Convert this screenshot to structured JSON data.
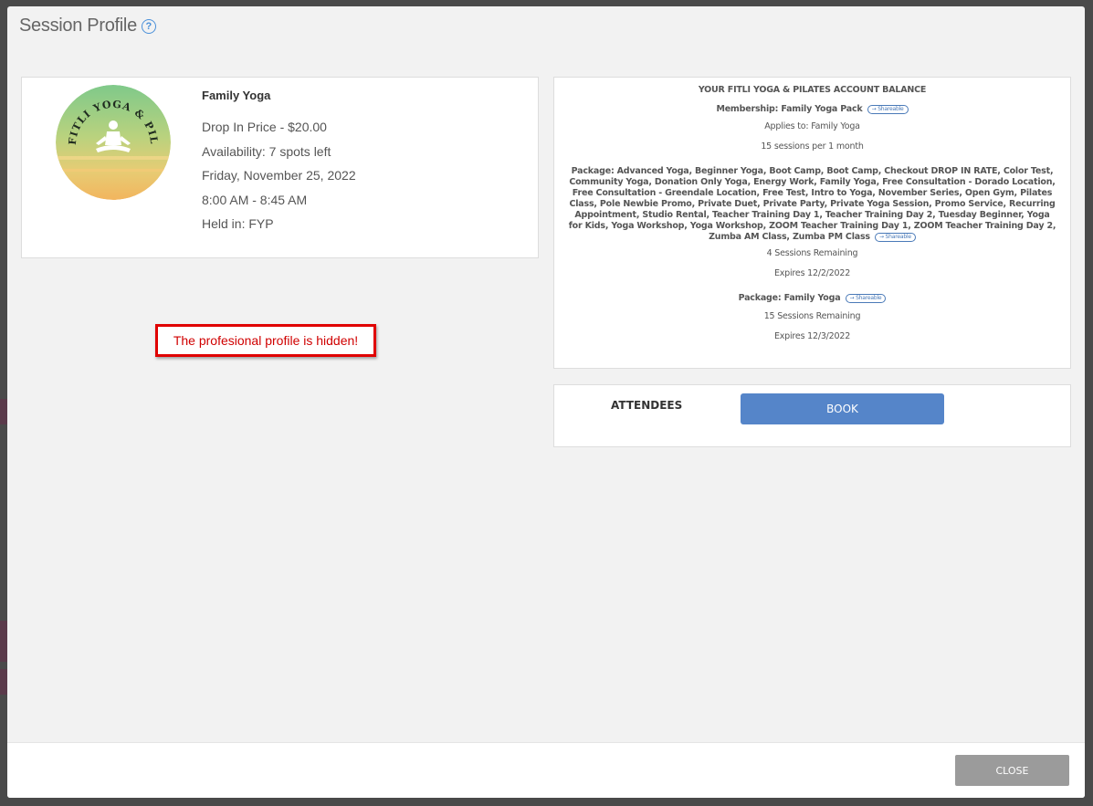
{
  "modal": {
    "title": "Session Profile",
    "help_icon": "?"
  },
  "session": {
    "logo_text": "FITLI YOGA & PILATES",
    "name": "Family Yoga",
    "price": "Drop In Price - $20.00",
    "availability": "Availability: 7 spots left",
    "date": "Friday, November 25, 2022",
    "time": "8:00 AM - 8:45 AM",
    "location": "Held in: FYP"
  },
  "notice": {
    "text": "The profesional profile is hidden!"
  },
  "balance": {
    "title": "YOUR FITLI YOGA & PILATES ACCOUNT BALANCE",
    "membership": {
      "label": "Membership: Family Yoga Pack",
      "badge": "Shareable",
      "applies_to": "Applies to: Family Yoga",
      "sessions": "15 sessions per 1 month"
    },
    "package1": {
      "label": "Package: Advanced Yoga, Beginner Yoga, Boot Camp, Boot Camp, Checkout DROP IN RATE, Color Test, Community Yoga, Donation Only Yoga, Energy Work, Family Yoga, Free Consultation - Dorado Location, Free Consultation - Greendale Location, Free Test, Intro to Yoga, November Series, Open Gym, Pilates Class, Pole Newbie Promo, Private Duet, Private Party, Private Yoga Session, Promo Service, Recurring Appointment, Studio Rental, Teacher Training Day 1, Teacher Training Day 2, Tuesday Beginner, Yoga for Kids, Yoga Workshop, Yoga Workshop, ZOOM Teacher Training Day 1, ZOOM Teacher Training Day 2, Zumba AM Class, Zumba PM Class",
      "badge": "Shareable",
      "remaining": "4 Sessions Remaining",
      "expires": "Expires 12/2/2022"
    },
    "package2": {
      "label": "Package: Family Yoga",
      "badge": "Shareable",
      "remaining": "15 Sessions Remaining",
      "expires": "Expires 12/3/2022"
    }
  },
  "attendees": {
    "label": "ATTENDEES",
    "book_label": "BOOK"
  },
  "footer": {
    "close_label": "CLOSE"
  },
  "colors": {
    "primary_button": "#5585c9",
    "close_button": "#9b9b9b",
    "notice_red": "#e00000"
  }
}
